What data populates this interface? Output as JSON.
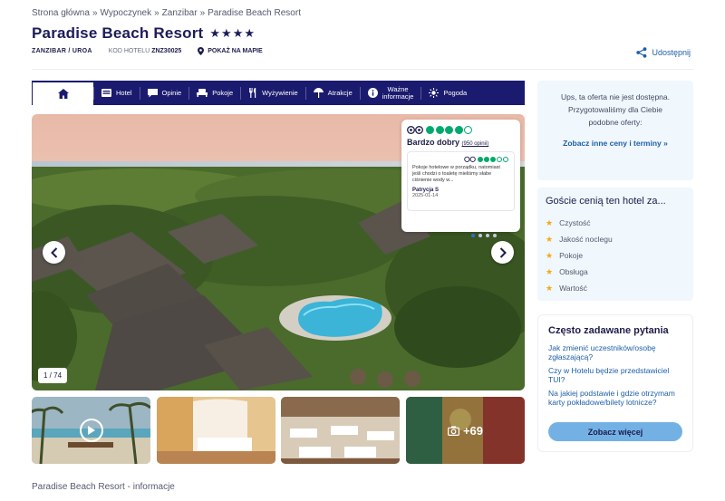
{
  "breadcrumb": {
    "items": [
      "Strona główna",
      "Wypoczynek",
      "Zanzibar",
      "Paradise Beach Resort"
    ],
    "separator": "»"
  },
  "hotel": {
    "title": "Paradise Beach Resort",
    "stars": "★★★★",
    "location": "ZANZIBAR / UROA",
    "code_label": "KOD HOTELU",
    "code_value": "ZNZ30025",
    "map_label": "POKAŻ NA MAPIE"
  },
  "share": {
    "label": "Udostępnij"
  },
  "tabs": [
    {
      "label": "Hotel",
      "icon": "bed-list-icon"
    },
    {
      "label": "Opinie",
      "icon": "comment-icon"
    },
    {
      "label": "Pokoje",
      "icon": "bed-icon"
    },
    {
      "label": "Wyżywienie",
      "icon": "cutlery-icon"
    },
    {
      "label": "Atrakcje",
      "icon": "umbrella-icon"
    },
    {
      "label_line1": "Ważne",
      "label_line2": "informacje",
      "icon": "info-icon"
    },
    {
      "label": "Pogoda",
      "icon": "sun-icon"
    }
  ],
  "gallery": {
    "counter": "1 / 74",
    "more_count": "+69",
    "thumbnails": [
      "video-thumbnail",
      "room-thumbnail",
      "restaurant-thumbnail",
      "more-photos-thumbnail"
    ]
  },
  "review": {
    "rating_dots": 4.5,
    "rating_text": "Bardzo dobry",
    "count_text": "(950 opinii)",
    "inner_rating_dots": 3,
    "text": "Pokoje hotelowe w porządku, natomiast jeśli chodzi o toaletę mieliśmy słabe ciśnienie wody w...",
    "author": "Patrycja S",
    "date": "2025-01-14",
    "pager_count": 4,
    "pager_active": 0
  },
  "unavailable": {
    "message": "Ups, ta oferta nie jest dostępna. Przygotowaliśmy dla Ciebie podobne oferty:",
    "link": "Zobacz inne ceny i terminy »"
  },
  "guests_value": {
    "heading": "Goście cenią ten hotel za...",
    "categories": [
      "Czystość",
      "Jakość noclegu",
      "Pokoje",
      "Obsługa",
      "Wartość"
    ]
  },
  "faq": {
    "heading": "Często zadawane pytania",
    "questions": [
      "Jak zmienić uczestników/osobę zgłaszającą?",
      "Czy w Hotelu będzie przedstawiciel TUI?",
      "Na jakiej podstawie i gdzie otrzymam karty pokładowe/bilety lotnicze?"
    ],
    "button": "Zobacz więcej"
  },
  "info_heading": "Paradise Beach Resort - informacje",
  "colors": {
    "navy": "#1a1a6e",
    "link_blue": "#1e5fa8",
    "tripadvisor_green": "#00aa6c",
    "star_orange": "#f4a81d",
    "light_panel": "#f0f7fd",
    "button_blue": "#73b1e5"
  }
}
